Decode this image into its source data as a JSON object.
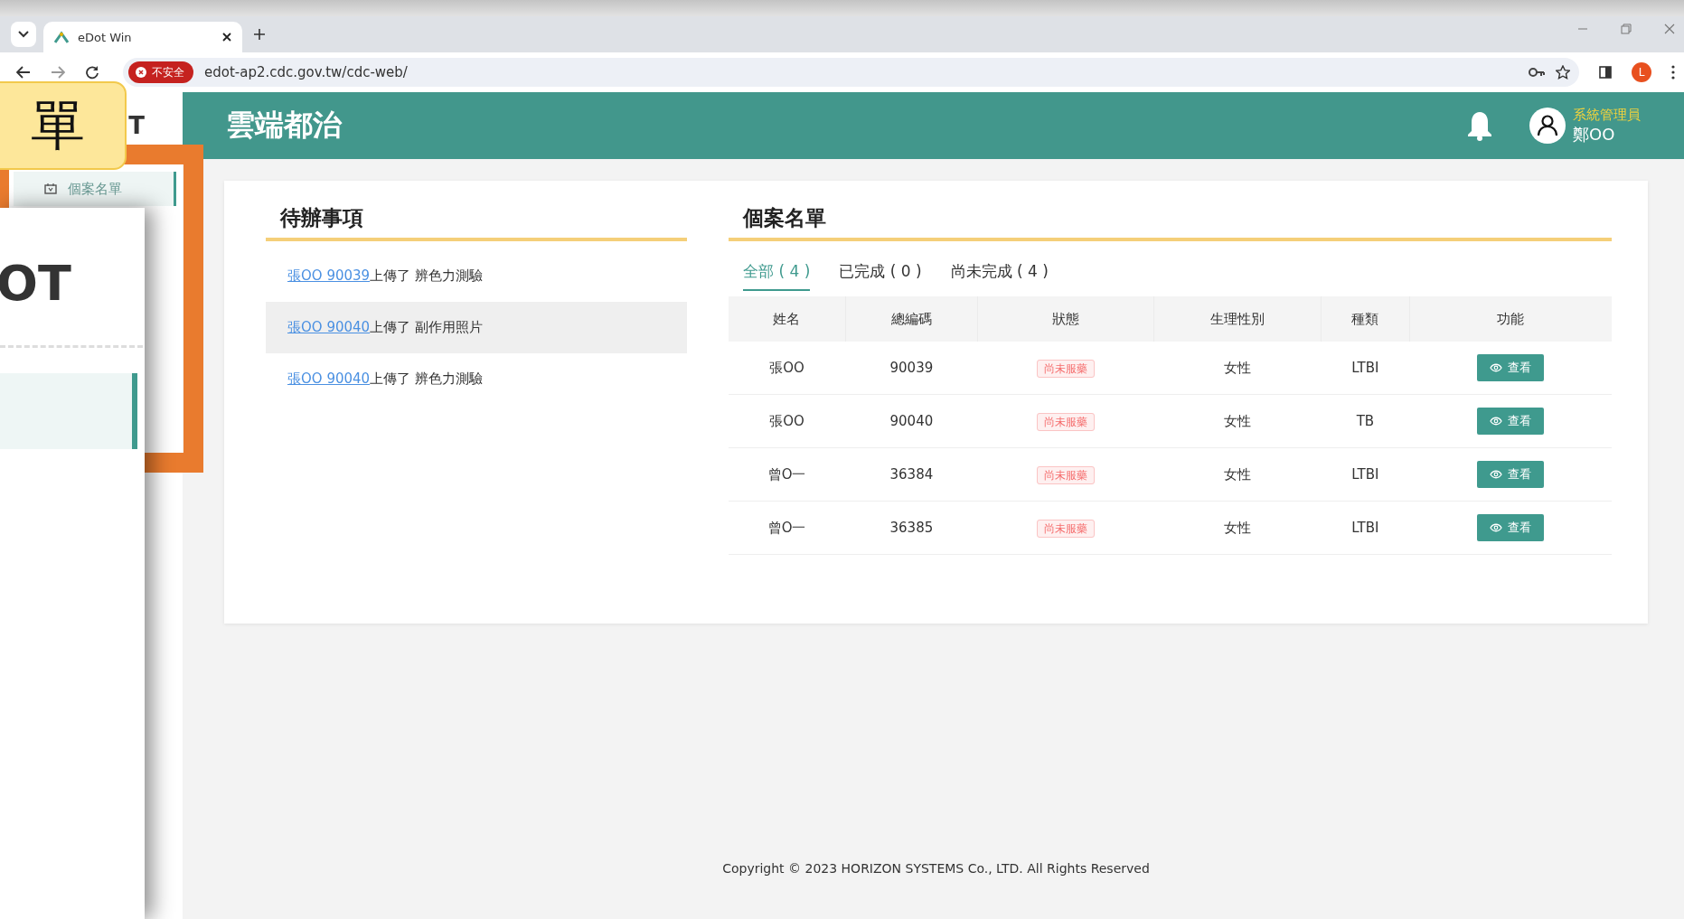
{
  "browser": {
    "tab_title": "eDot Win",
    "security_label": "不安全",
    "url": "edot-ap2.cdc.gov.tw/cdc-web/",
    "profile_initial": "L"
  },
  "annotation": {
    "callout": "單",
    "zoom_logo": "OT"
  },
  "sidebar": {
    "logo": "T",
    "items": [
      {
        "label": "個案名單",
        "selected": true
      }
    ]
  },
  "header": {
    "title": "雲端都治",
    "role": "系統管理員",
    "user": "鄭OO"
  },
  "todo": {
    "title": "待辦事項",
    "items": [
      {
        "link": "張OO 90039",
        "text": "上傳了 辨色力測驗",
        "hovered": false
      },
      {
        "link": "張OO 90040",
        "text": "上傳了 副作用照片",
        "hovered": true
      },
      {
        "link": "張OO 90040",
        "text": "上傳了 辨色力測驗",
        "hovered": false
      }
    ]
  },
  "cases": {
    "title": "個案名單",
    "tabs": [
      {
        "label": "全部 ( 4 )",
        "selected": true
      },
      {
        "label": "已完成 ( 0 )",
        "selected": false
      },
      {
        "label": "尚未完成 ( 4 )",
        "selected": false
      }
    ],
    "columns": [
      "姓名",
      "總編碼",
      "狀態",
      "生理性別",
      "種類",
      "功能"
    ],
    "rows": [
      {
        "name": "張OO",
        "code": "90039",
        "status": "尚未服藥",
        "sex": "女性",
        "type": "LTBI",
        "action": "查看"
      },
      {
        "name": "張OO",
        "code": "90040",
        "status": "尚未服藥",
        "sex": "女性",
        "type": "TB",
        "action": "查看"
      },
      {
        "name": "曾O一",
        "code": "36384",
        "status": "尚未服藥",
        "sex": "女性",
        "type": "LTBI",
        "action": "查看"
      },
      {
        "name": "曾O一",
        "code": "36385",
        "status": "尚未服藥",
        "sex": "女性",
        "type": "LTBI",
        "action": "查看"
      }
    ]
  },
  "footer": "Copyright © 2023 HORIZON SYSTEMS Co., LTD. All Rights Reserved"
}
